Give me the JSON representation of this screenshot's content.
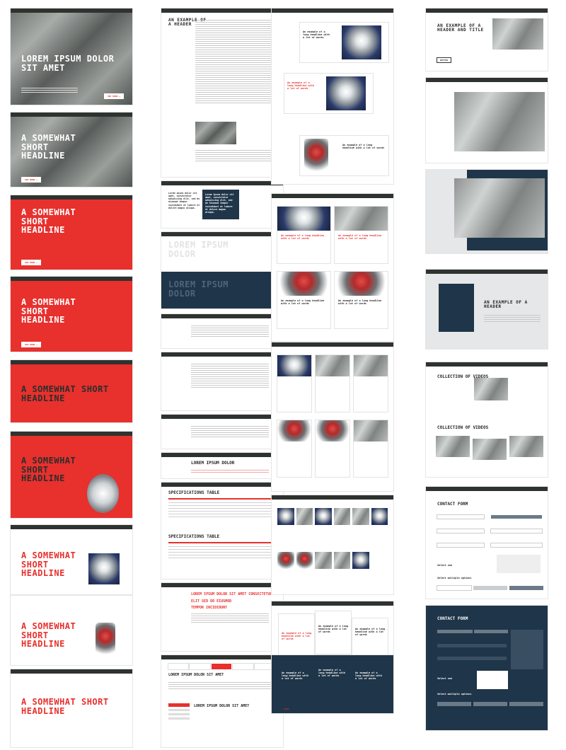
{
  "col1": {
    "b1": {
      "headline_1": "LOREM IPSUM DOLOR",
      "headline_2": "SIT AMET",
      "cta": "SEE MORE →"
    },
    "b2": {
      "headline_1": "A SOMEWHAT",
      "headline_2": "SHORT",
      "headline_3": "HEADLINE",
      "cta": "SEE MORE →"
    },
    "b3": {
      "headline_1": "A SOMEWHAT",
      "headline_2": "SHORT",
      "headline_3": "HEADLINE",
      "cta": "SEE MORE →"
    },
    "b4": {
      "headline_1": "A SOMEWHAT",
      "headline_2": "SHORT",
      "headline_3": "HEADLINE",
      "cta": "SEE MORE →"
    },
    "b5": {
      "headline_1": "A SOMEWHAT SHORT",
      "headline_2": "HEADLINE"
    },
    "b6": {
      "headline_1": "A SOMEWHAT",
      "headline_2": "SHORT",
      "headline_3": "HEADLINE"
    },
    "b7": {
      "headline_1": "A SOMEWHAT",
      "headline_2": "SHORT",
      "headline_3": "HEADLINE"
    },
    "b8": {
      "headline_1": "A SOMEWHAT",
      "headline_2": "SHORT",
      "headline_3": "HEADLINE"
    },
    "b9": {
      "headline_1": "A SOMEWHAT SHORT",
      "headline_2": "HEADLINE"
    }
  },
  "col2": {
    "article": {
      "title_1": "AN EXAMPLE OF",
      "title_2": "A HEADER"
    },
    "quote_1": "Lorem ipsum dolor sit amet, consectetur adipiscing elit, sed do eiusmod tempor incididunt ut labore et dolore magna aliqua.",
    "quote_2": "Lorem ipsum dolor sit amet, consectetur adipiscing elit, sed do eiusmod tempor incididunt ut labore et dolore magna aliqua.",
    "big_text_1": "LOREM IPSUM",
    "big_text_2": "DOLOR",
    "big_text_3": "LOREM IPSUM",
    "big_text_4": "DOLOR",
    "list_heading": "LOREM IPSUM DOLOR",
    "spec_title_1": "SPECIFICATIONS TABLE",
    "spec_title_2": "SPECIFICATIONS TABLE",
    "accordion": [
      "LOREM IPSUM DOLOR SIT AMET CONSECTETUR",
      "ELIT SED DO EIUSMOD",
      "TEMPOR INCIDIDUNT"
    ],
    "tabs_title": "LOREM IPSUM DOLOR SIT AMET",
    "tabs_sub": "LOREM IPSUM DOLOR SIT AMET"
  },
  "col3": {
    "card_title": "An example of a long headline with a lot of words",
    "card_title_red": "An example of a long headline with a lot of words",
    "more": "→ MORE"
  },
  "col4": {
    "header_1": "AN EXAMPLE OF A",
    "header_2": "HEADER AND TITLE",
    "header_btn": "BUTTON",
    "header_3": "AN EXAMPLE OF A",
    "header_4": "HEADER",
    "videos_title_1": "COLLECTION OF VIDEOS",
    "videos_title_2": "COLLECTION OF VIDEOS",
    "form_title_1": "CONTACT FORM",
    "form_title_2": "CONTACT FORM",
    "select_one": "Select one",
    "select_multiple": "Select multiple options",
    "select_multiple_2": "Select multiple options"
  }
}
